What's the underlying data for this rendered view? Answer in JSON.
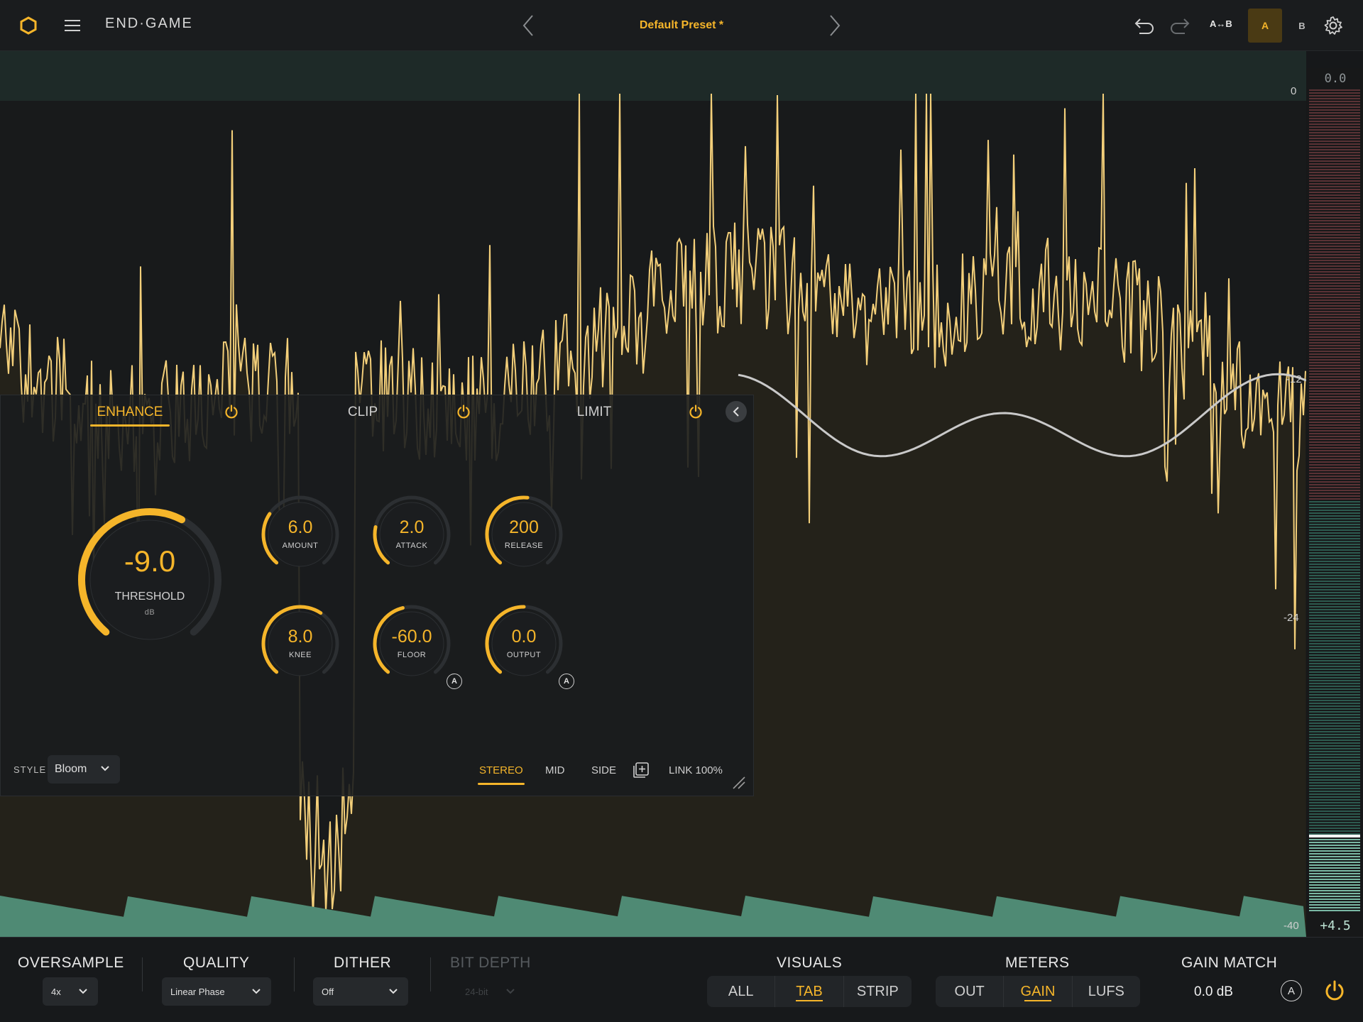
{
  "header": {
    "brand": "END·GAME",
    "preset_name": "Default Preset *",
    "ab_copy_label": "A↔B",
    "a_label": "A",
    "b_label": "B",
    "icons": [
      "logo-hexagon-icon",
      "menu-icon",
      "chevron-left-icon",
      "chevron-right-icon",
      "undo-icon",
      "redo-icon",
      "gear-icon"
    ]
  },
  "visualizer": {
    "scale_labels": [
      "0",
      "-12",
      "-24",
      "-40"
    ],
    "meter_top_value": "0.0",
    "meter_bottom_value": "+4.5"
  },
  "panel": {
    "tabs": [
      {
        "label": "ENHANCE",
        "active": true
      },
      {
        "label": "CLIP",
        "active": false
      },
      {
        "label": "LIMIT",
        "active": false
      }
    ],
    "threshold": {
      "value": "-9.0",
      "label": "THRESHOLD",
      "unit": "dB"
    },
    "knobs": [
      {
        "value": "6.0",
        "label": "AMOUNT",
        "fill": 0.3
      },
      {
        "value": "2.0",
        "label": "ATTACK",
        "fill": 0.22
      },
      {
        "value": "200",
        "label": "RELEASE",
        "fill": 0.52
      },
      {
        "value": "8.0",
        "label": "KNEE",
        "fill": 0.62
      },
      {
        "value": "-60.0",
        "label": "FLOOR",
        "fill": 0.45,
        "auto": "A"
      },
      {
        "value": "0.0",
        "label": "OUTPUT",
        "fill": 0.5,
        "auto": "A"
      }
    ],
    "threshold_fill": 0.6,
    "style_label": "STYLE",
    "style_value": "Bloom",
    "channel_modes": [
      "STEREO",
      "MID",
      "SIDE"
    ],
    "active_channel": "STEREO",
    "link_label": "LINK 100%"
  },
  "bottom": {
    "oversample": {
      "title": "OVERSAMPLE",
      "value": "4x"
    },
    "quality": {
      "title": "QUALITY",
      "value": "Linear Phase"
    },
    "dither": {
      "title": "DITHER",
      "value": "Off"
    },
    "bit_depth": {
      "title": "BIT DEPTH",
      "value": "24-bit"
    },
    "visuals": {
      "title": "VISUALS",
      "options": [
        "ALL",
        "TAB",
        "STRIP"
      ],
      "active": "TAB"
    },
    "meters": {
      "title": "METERS",
      "options": [
        "OUT",
        "GAIN",
        "LUFS"
      ],
      "active": "GAIN"
    },
    "gain_match": {
      "title": "GAIN MATCH",
      "value": "0.0 dB",
      "auto_label": "A"
    }
  },
  "colors": {
    "accent": "#f5b52a",
    "bg": "#16181a",
    "gain_teal": "#4f8a74"
  }
}
